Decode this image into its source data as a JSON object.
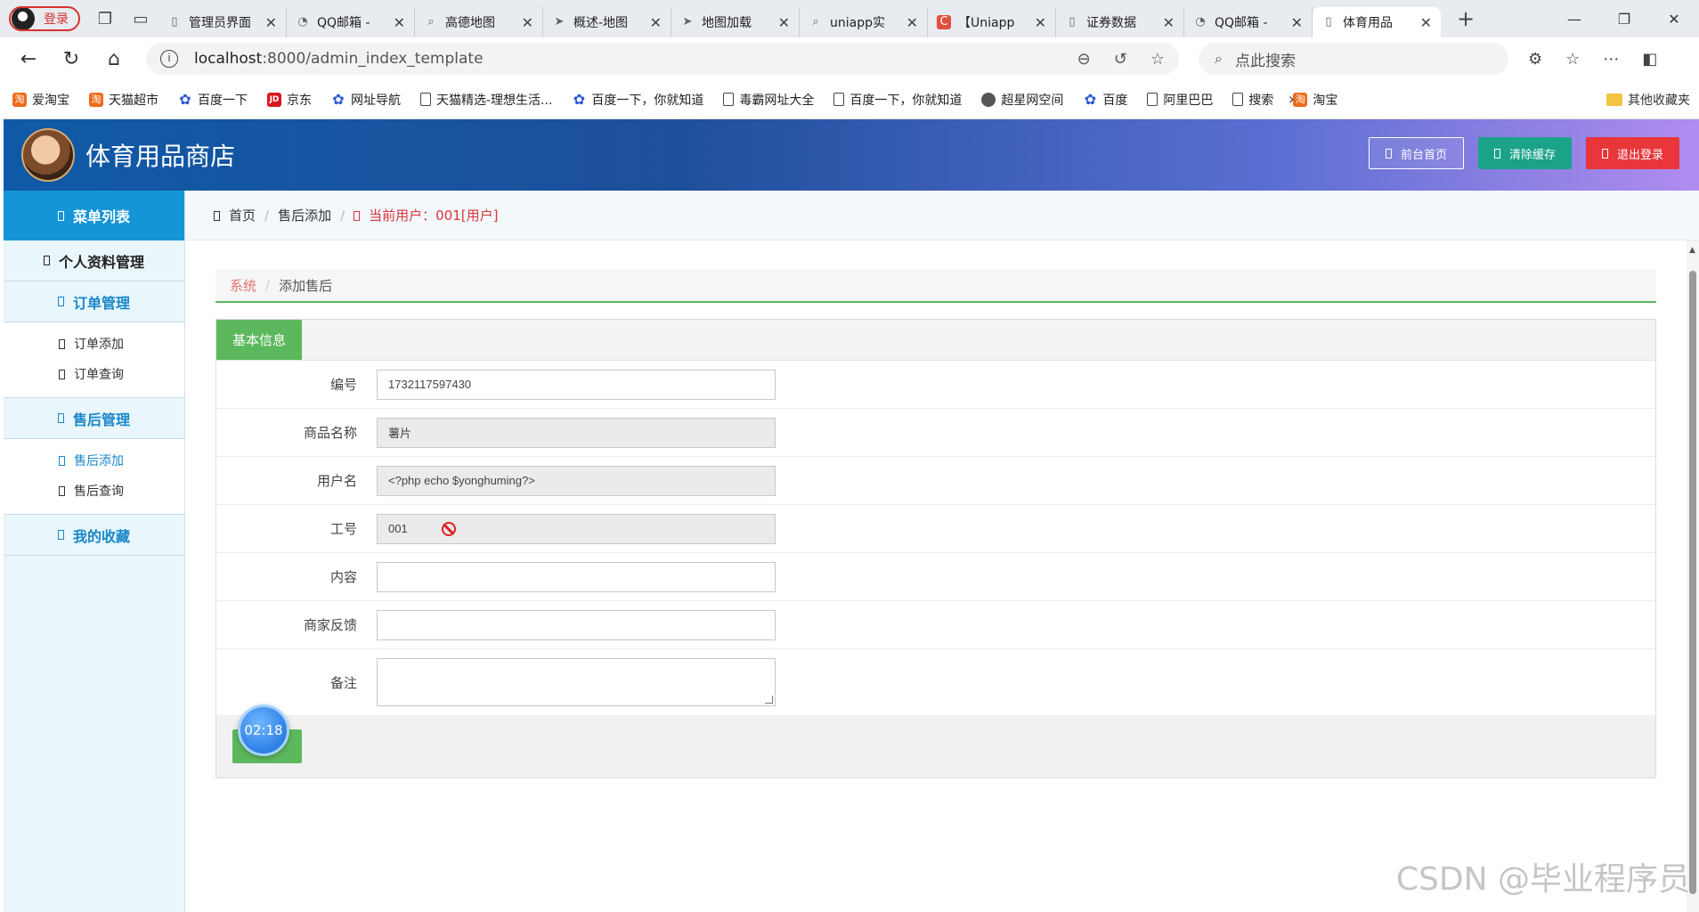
{
  "browser": {
    "login_label": "登录",
    "tabs": [
      {
        "title": "管理员界面",
        "icon": "page-icon"
      },
      {
        "title": "QQ邮箱 - ",
        "icon": "qqmail-icon"
      },
      {
        "title": "高德地图 ",
        "icon": "search-icon"
      },
      {
        "title": "概述-地图",
        "icon": "amap-icon"
      },
      {
        "title": "地图加载",
        "icon": "amap-icon"
      },
      {
        "title": "uniapp实",
        "icon": "search-icon"
      },
      {
        "title": "【Uniapp",
        "icon": "csdn-icon"
      },
      {
        "title": "证券数据",
        "icon": "page-icon"
      },
      {
        "title": "QQ邮箱 - ",
        "icon": "qqmail-icon"
      },
      {
        "title": "体育用品",
        "icon": "page-icon",
        "active": true
      }
    ],
    "url_host": "localhost",
    "url_path": ":8000/admin_index_template",
    "search_placeholder": "点此搜索",
    "bookmarks": [
      {
        "label": "爱淘宝",
        "icon": "taobao"
      },
      {
        "label": "天猫超市",
        "icon": "taobao"
      },
      {
        "label": "百度一下",
        "icon": "baidu"
      },
      {
        "label": "京东",
        "icon": "jd"
      },
      {
        "label": "网址导航",
        "icon": "baidu"
      },
      {
        "label": "天猫精选-理想生活...",
        "icon": "page"
      },
      {
        "label": "百度一下，你就知道",
        "icon": "baidu"
      },
      {
        "label": "毒霸网址大全",
        "icon": "page"
      },
      {
        "label": "百度一下，你就知道",
        "icon": "page"
      },
      {
        "label": "超星网空间",
        "icon": "globe"
      },
      {
        "label": "百度",
        "icon": "baidu"
      },
      {
        "label": "阿里巴巴",
        "icon": "page"
      },
      {
        "label": "搜索",
        "icon": "page"
      },
      {
        "label": "淘宝",
        "icon": "taobao"
      }
    ],
    "other_bookmarks": "其他收藏夹"
  },
  "header": {
    "title": "体育用品商店",
    "btn_front": "前台首页",
    "btn_cache": "清除缓存",
    "btn_logout": "退出登录"
  },
  "sidebar": {
    "menu_title": "菜单列表",
    "profile": "个人资料管理",
    "orders": "订单管理",
    "order_add": "订单添加",
    "order_query": "订单查询",
    "aftersale": "售后管理",
    "aftersale_add": "售后添加",
    "aftersale_query": "售后查询",
    "favorites": "我的收藏"
  },
  "topbar": {
    "home": "首页",
    "page": "售后添加",
    "current_user": "当前用户：001[用户]"
  },
  "crumb": {
    "system": "系统",
    "page": "添加售后"
  },
  "form": {
    "section_tab": "基本信息",
    "fields": {
      "number_label": "编号",
      "number_value": "1732117597430",
      "product_label": "商品名称",
      "product_value": "薯片",
      "username_label": "用户名",
      "username_value": "<?php echo $yonghuming?>",
      "jobno_label": "工号",
      "jobno_value": "001",
      "content_label": "内容",
      "feedback_label": "商家反馈",
      "remark_label": "备注"
    },
    "timer": "02:18"
  },
  "watermark": "CSDN @毕业程序员"
}
